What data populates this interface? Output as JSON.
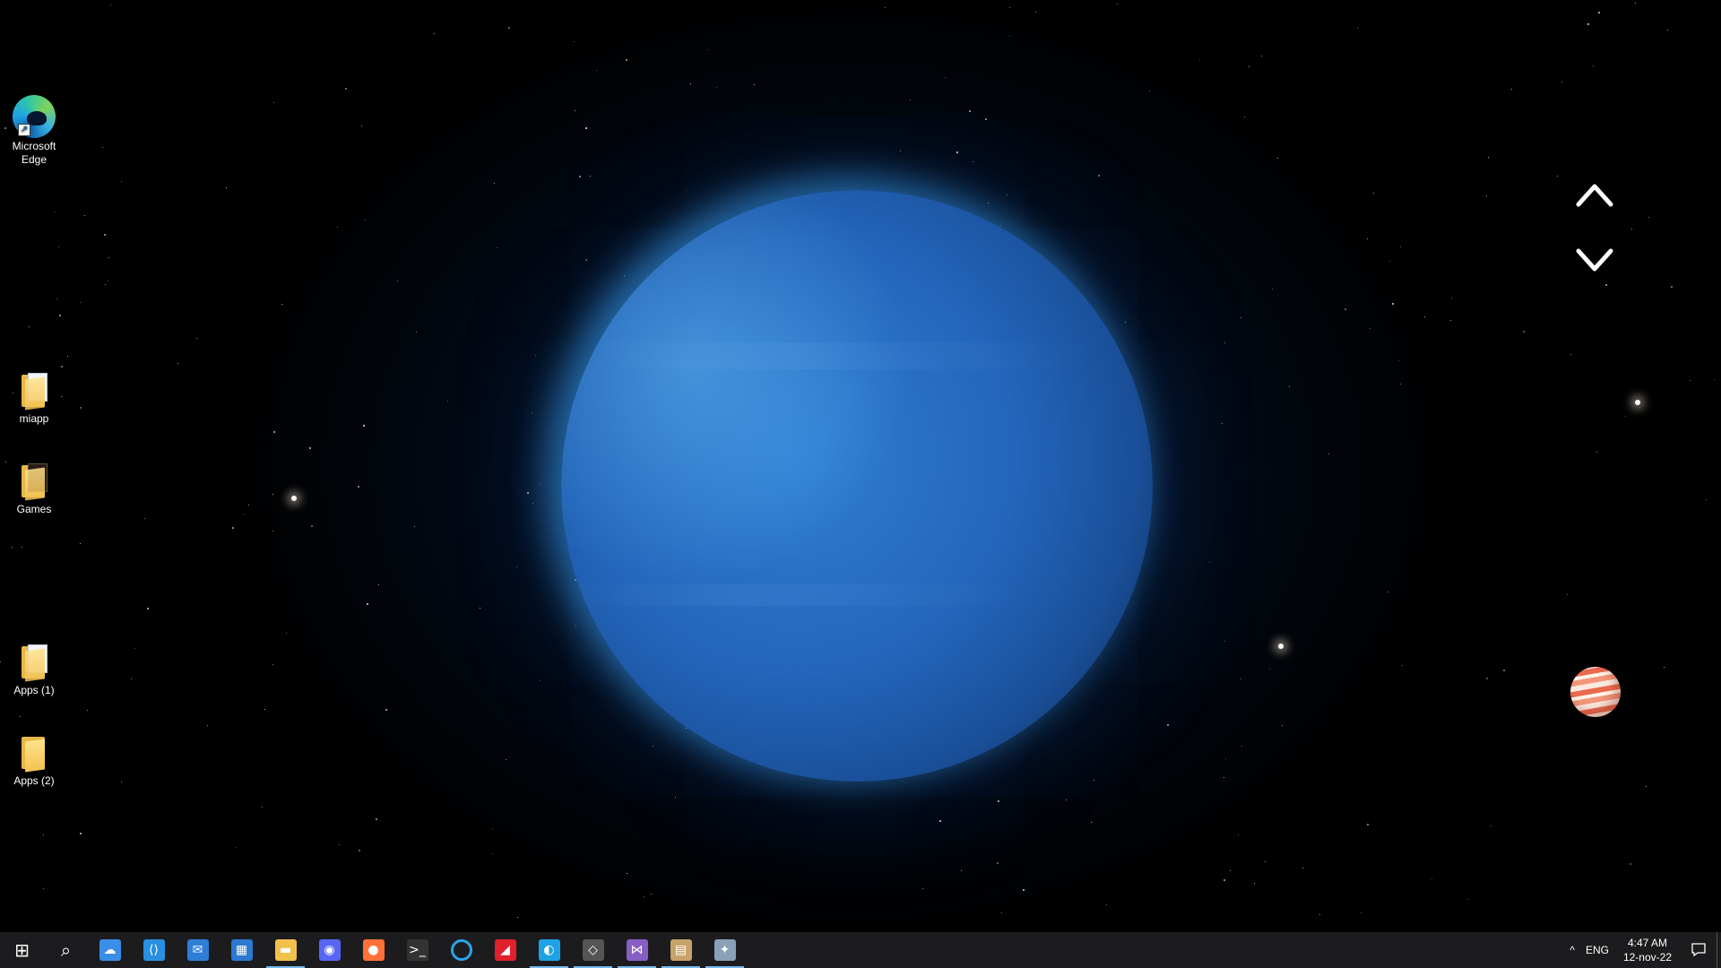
{
  "desktop": {
    "icons": [
      {
        "label": "Microsoft Edge",
        "icon": "edge-icon"
      },
      {
        "label": "miapp",
        "icon": "folder-icon"
      },
      {
        "label": "Games",
        "icon": "folder-icon"
      },
      {
        "label": "Apps (1)",
        "icon": "folder-icon"
      },
      {
        "label": "Apps (2)",
        "icon": "folder-icon"
      }
    ]
  },
  "wallpaper_app": {
    "up_icon": "chevron-up-icon",
    "down_icon": "chevron-down-icon",
    "planet_button_icon": "jupiter-icon"
  },
  "taskbar": {
    "apps": [
      {
        "name": "start",
        "icon": "windows-icon",
        "glyph": "⊞",
        "color": "#ffffff",
        "active": false
      },
      {
        "name": "search",
        "icon": "search-icon",
        "glyph": "⌕",
        "color": "#ffffff",
        "active": false
      },
      {
        "name": "weather",
        "icon": "weather-icon",
        "glyph": "☁",
        "color": "#3a8ee6",
        "active": false
      },
      {
        "name": "vscode",
        "icon": "vscode-icon",
        "glyph": "⟨⟩",
        "color": "#2a8fe0",
        "active": false
      },
      {
        "name": "mail",
        "icon": "mail-icon",
        "glyph": "✉",
        "color": "#2e7dd6",
        "active": false
      },
      {
        "name": "store",
        "icon": "store-icon",
        "glyph": "▦",
        "color": "#2b79d1",
        "active": false
      },
      {
        "name": "file-explorer",
        "icon": "folder-icon",
        "glyph": "▬",
        "color": "#f1c14a",
        "active": true
      },
      {
        "name": "discord",
        "icon": "discord-icon",
        "glyph": "◉",
        "color": "#5865f2",
        "active": false
      },
      {
        "name": "firefox",
        "icon": "firefox-icon",
        "glyph": "●",
        "color": "#ff7139",
        "active": false
      },
      {
        "name": "terminal",
        "icon": "terminal-icon",
        "glyph": ">_",
        "color": "#333333",
        "active": false
      },
      {
        "name": "cortana",
        "icon": "cortana-icon",
        "glyph": "○",
        "color": "#1c1c1f",
        "active": false
      },
      {
        "name": "amd",
        "icon": "amd-icon",
        "glyph": "◢",
        "color": "#e0202b",
        "active": false
      },
      {
        "name": "edge",
        "icon": "edge-icon",
        "glyph": "◐",
        "color": "#1fa2e5",
        "active": true
      },
      {
        "name": "unity",
        "icon": "unity-icon",
        "glyph": "◇",
        "color": "#555555",
        "active": true
      },
      {
        "name": "visual-studio",
        "icon": "visual-studio-icon",
        "glyph": "⋈",
        "color": "#865fc5",
        "active": true
      },
      {
        "name": "app-window",
        "icon": "app-window-icon",
        "glyph": "▤",
        "color": "#c7a36a",
        "active": true
      },
      {
        "name": "space-app",
        "icon": "planet-app-icon",
        "glyph": "✦",
        "color": "#8aa0b8",
        "active": true
      }
    ],
    "tray": {
      "chevron": "^",
      "language": "ENG",
      "time": "4:47 AM",
      "date": "12-nov-22"
    }
  },
  "colors": {
    "taskbar_bg": "#1c1c1f",
    "accent": "#76b9ed",
    "planet": "#2366bb"
  }
}
